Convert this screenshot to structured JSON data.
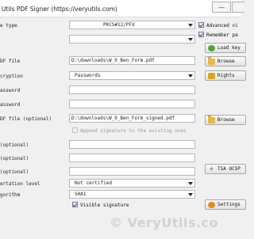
{
  "window": {
    "title": "Utils PDF Signer (https://veryutils.com)",
    "minimize_label": "—",
    "close_label": ""
  },
  "form": {
    "key_type_label": "e type",
    "key_type_value": "PKCS#12/PFX",
    "key_label": "",
    "key_value": "",
    "input_file_label": "DF file",
    "input_file_value": "D:\\downloads\\W_9_Ben_Form.pdf",
    "encryption_label": "cryption",
    "encryption_value": "Passwords",
    "password_label": "assword",
    "password_value": "",
    "password2_label": "assword",
    "password2_value": "",
    "output_file_label": "DF file (optional)",
    "output_file_value": "D:\\downloads\\W_9_Ben_Form_signed.pdf",
    "append_signature_text": "Append signature to the existing ones",
    "reason_label": "(optional)",
    "reason_value": "",
    "location_label": "(optional)",
    "location_value": "",
    "contact_label": "(optional)",
    "contact_value": "",
    "certification_label": "ertation level",
    "certification_value": "Not certified",
    "hash_label": "gorithm",
    "hash_value": "SHA1",
    "visible_signature_text": "Visible signature"
  },
  "options": {
    "advanced_view_text": "Advanced vi",
    "remember_pass_text": "Remember pa"
  },
  "buttons": {
    "load_keys": "Load key",
    "browse_input": "Browse",
    "rights": "Rights",
    "browse_output": "Browse",
    "tsa_ocsp": "TSA OCSP",
    "settings": "Settings"
  },
  "footer": {
    "watermark": "© VeryUtils.co"
  },
  "colors": {
    "background": "#f0f0f0",
    "check_color": "#2a4fa0",
    "load_key_icon": "#5aa03a",
    "folder_icon": "#e6b84a"
  }
}
